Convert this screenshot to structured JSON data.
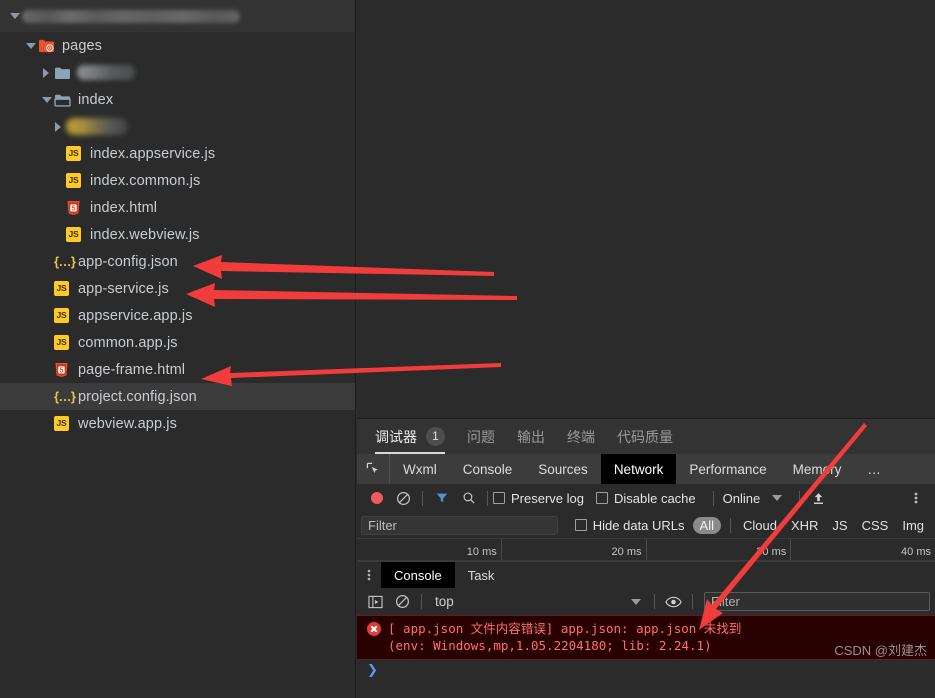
{
  "explorer": {
    "project_name_redacted": true,
    "tree": [
      {
        "depth": 1,
        "twisty": "expanded",
        "icon": "folder-pages-icon",
        "label": "pages",
        "selected": false
      },
      {
        "depth": 2,
        "twisty": "collapsed",
        "icon": "folder-icon",
        "label": "",
        "redacted": true,
        "selected": false
      },
      {
        "depth": 2,
        "twisty": "expanded",
        "icon": "folder-open-icon",
        "label": "index",
        "selected": false
      },
      {
        "depth": 3,
        "twisty": "collapsed",
        "icon": "folder-gold-icon",
        "label": "",
        "redacted_gold": true,
        "selected": false
      },
      {
        "depth": 3,
        "twisty": "none",
        "icon": "js-file-icon",
        "label": "index.appservice.js",
        "selected": false
      },
      {
        "depth": 3,
        "twisty": "none",
        "icon": "js-file-icon",
        "label": "index.common.js",
        "selected": false
      },
      {
        "depth": 3,
        "twisty": "none",
        "icon": "html-file-icon",
        "label": "index.html",
        "selected": false
      },
      {
        "depth": 3,
        "twisty": "none",
        "icon": "js-file-icon",
        "label": "index.webview.js",
        "selected": false
      },
      {
        "depth": 2,
        "twisty": "none",
        "icon": "json-file-icon",
        "label": "app-config.json",
        "selected": false
      },
      {
        "depth": 2,
        "twisty": "none",
        "icon": "js-file-icon",
        "label": "app-service.js",
        "selected": false
      },
      {
        "depth": 2,
        "twisty": "none",
        "icon": "js-file-icon",
        "label": "appservice.app.js",
        "selected": false
      },
      {
        "depth": 2,
        "twisty": "none",
        "icon": "js-file-icon",
        "label": "common.app.js",
        "selected": false
      },
      {
        "depth": 2,
        "twisty": "none",
        "icon": "html-file-icon",
        "label": "page-frame.html",
        "selected": false
      },
      {
        "depth": 2,
        "twisty": "none",
        "icon": "json-file-icon",
        "label": "project.config.json",
        "selected": true
      },
      {
        "depth": 2,
        "twisty": "none",
        "icon": "js-file-icon",
        "label": "webview.app.js",
        "selected": false
      }
    ]
  },
  "devtools": {
    "outer_tabs": [
      {
        "label": "调试器",
        "badge": "1",
        "active": true
      },
      {
        "label": "问题",
        "badge": "",
        "active": false
      },
      {
        "label": "输出",
        "badge": "",
        "active": false
      },
      {
        "label": "终端",
        "badge": "",
        "active": false
      },
      {
        "label": "代码质量",
        "badge": "",
        "active": false
      }
    ],
    "panel_tabs": [
      {
        "label": "Wxml",
        "active": false
      },
      {
        "label": "Console",
        "active": false
      },
      {
        "label": "Sources",
        "active": false
      },
      {
        "label": "Network",
        "active": true
      },
      {
        "label": "Performance",
        "active": false
      },
      {
        "label": "Memory",
        "active": false
      },
      {
        "label": "…",
        "active": false
      }
    ],
    "inspect_icon": "inspect-element-icon",
    "network_toolbar": {
      "record_icon": "record-icon",
      "clear_icon": "clear-icon",
      "filter_icon": "filter-funnel-icon",
      "search_icon": "search-icon",
      "preserve_log_label": "Preserve log",
      "preserve_log_checked": false,
      "disable_cache_label": "Disable cache",
      "disable_cache_checked": false,
      "throttling_value": "Online",
      "import_icon": "upload-icon",
      "overflow_icon": "kebab-menu-icon"
    },
    "filter_bar": {
      "filter_placeholder": "Filter",
      "filter_value": "",
      "hide_data_urls_label": "Hide data URLs",
      "hide_data_urls_checked": false,
      "types": [
        "All",
        "Cloud",
        "XHR",
        "JS",
        "CSS",
        "Img"
      ],
      "selected_type": "All"
    },
    "timeline_ticks": [
      "10 ms",
      "20 ms",
      "30 ms",
      "40 ms"
    ],
    "drawer_tabs": [
      {
        "label": "Console",
        "active": true
      },
      {
        "label": "Task",
        "active": false
      }
    ],
    "console_toolbar": {
      "sidebar_icon": "console-sidebar-icon",
      "clear_icon": "clear-console-icon",
      "context": "top",
      "eye_icon": "live-expression-icon",
      "filter_placeholder": "Filter",
      "filter_value": ""
    },
    "console_messages": [
      {
        "level": "error",
        "line1": "[ app.json 文件内容错误] app.json: app.json 未找到",
        "line2": "(env: Windows,mp,1.05.2204180; lib: 2.24.1)"
      }
    ],
    "prompt": "❯",
    "watermark": "CSDN @刘建杰"
  },
  "annotations": {
    "arrow_color": "#f23c3c",
    "arrows": [
      {
        "name": "arrow-to-app-config-json",
        "points_at": "app-config.json"
      },
      {
        "name": "arrow-to-app-service-js",
        "points_at": "app-service.js"
      },
      {
        "name": "arrow-to-page-frame-html",
        "points_at": "page-frame.html"
      },
      {
        "name": "arrow-to-console-filter",
        "points_at": "console filter input"
      }
    ]
  },
  "colors": {
    "background": "#2b2b2b",
    "panel_header": "#333333",
    "tabstrip": "#3c3c3c",
    "selected_row": "#3b3b3b",
    "active_tab": "#000000",
    "js_icon": "#ffca28",
    "html_icon": "#e8512e",
    "json_icon": "#e8c250",
    "error_bg": "#290000",
    "error_text": "#ff6f6f",
    "accent_red": "#f23c3c"
  }
}
